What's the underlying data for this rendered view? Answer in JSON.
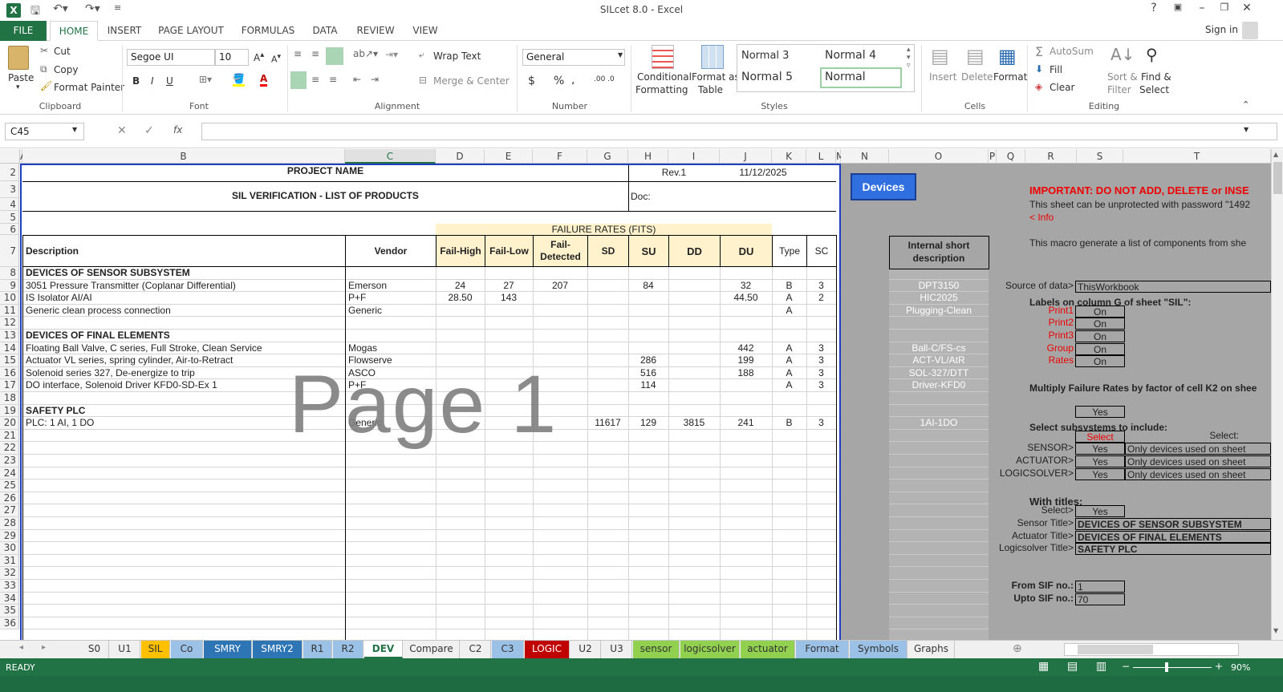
{
  "window": {
    "title": "SILcet 8.0 - Excel",
    "help": "?",
    "signin": "Sign in"
  },
  "menu": {
    "file": "FILE",
    "tabs": [
      "HOME",
      "INSERT",
      "PAGE LAYOUT",
      "FORMULAS",
      "DATA",
      "REVIEW",
      "VIEW"
    ]
  },
  "ribbon": {
    "clipboard": {
      "paste": "Paste",
      "cut": "Cut",
      "copy": "Copy",
      "format_painter": "Format Painter",
      "label": "Clipboard"
    },
    "font": {
      "name": "Segoe UI",
      "size": "10",
      "label": "Font",
      "bold": "B",
      "italic": "I",
      "underline": "U"
    },
    "alignment": {
      "wrap": "Wrap Text",
      "merge": "Merge & Center",
      "label": "Alignment"
    },
    "number": {
      "format": "General",
      "currency": "$",
      "percent": "%",
      "comma": ",",
      "inc": ".00 .0",
      "dec": ".00 .0",
      "label": "Number"
    },
    "styles": {
      "conditional": "Conditional",
      "conditional2": "Formatting",
      "format_as": "Format as",
      "format_as2": "Table",
      "normal3": "Normal 3",
      "normal4": "Normal 4",
      "normal5": "Normal 5",
      "normal": "Normal",
      "label": "Styles"
    },
    "cells": {
      "insert": "Insert",
      "delete": "Delete",
      "format": "Format",
      "label": "Cells"
    },
    "editing": {
      "autosum": "AutoSum",
      "fill": "Fill",
      "clear": "Clear",
      "sort": "Sort &",
      "sort2": "Filter",
      "find": "Find &",
      "find2": "Select",
      "label": "Editing"
    }
  },
  "formula_bar": {
    "namebox": "C45",
    "fx": "fx",
    "value": ""
  },
  "columns": [
    "A",
    "B",
    "C",
    "D",
    "E",
    "F",
    "G",
    "H",
    "I",
    "J",
    "K",
    "L",
    "M",
    "N",
    "O",
    "P",
    "Q",
    "R",
    "S",
    "T"
  ],
  "rows": [
    "2",
    "3",
    "4",
    "5",
    "6",
    "7",
    "8",
    "9",
    "10",
    "11",
    "12",
    "13",
    "14",
    "15",
    "16",
    "17",
    "18",
    "19",
    "20",
    "21",
    "22",
    "23",
    "24",
    "25",
    "26",
    "27",
    "28",
    "29",
    "30",
    "31",
    "32",
    "33",
    "34",
    "35",
    "36"
  ],
  "sheet": {
    "project_name": "PROJECT NAME",
    "rev": "Rev.1",
    "date": "11/12/2025",
    "title": "SIL VERIFICATION - LIST OF PRODUCTS",
    "doc": "Doc:",
    "failure_rates": "FAILURE RATES (FITS)",
    "headers": [
      "Description",
      "Vendor",
      "Fail-High",
      "Fail-Low",
      "Fail-Detected",
      "SD",
      "SU",
      "DD",
      "DU",
      "Type",
      "SC"
    ],
    "watermark": "Page 1",
    "rows": [
      {
        "desc": "DEVICES OF SENSOR SUBSYSTEM",
        "bold": true
      },
      {
        "desc": "3051 Pressure Transmitter (Coplanar Differential)",
        "vendor": "Emerson",
        "fh": "24",
        "fl": "27",
        "fd": "207",
        "sd": "",
        "su": "84",
        "dd": "",
        "du": "32",
        "type": "B",
        "sc": "3",
        "short": "DPT3150"
      },
      {
        "desc": "IS Isolator AI/AI",
        "vendor": "P+F",
        "fh": "28.50",
        "fl": "143",
        "fd": "",
        "sd": "",
        "su": "",
        "dd": "",
        "du": "44.50",
        "type": "A",
        "sc": "2",
        "short": "HIC2025"
      },
      {
        "desc": "Generic clean process connection",
        "vendor": "Generic",
        "fh": "",
        "fl": "",
        "fd": "",
        "sd": "",
        "su": "",
        "dd": "",
        "du": "",
        "type": "A",
        "sc": "",
        "short": "Plugging-Clean"
      },
      {
        "desc": ""
      },
      {
        "desc": "DEVICES OF FINAL ELEMENTS",
        "bold": true
      },
      {
        "desc": "Floating Ball Valve, C series, Full Stroke, Clean Service",
        "vendor": "Mogas",
        "fh": "",
        "fl": "",
        "fd": "",
        "sd": "",
        "su": "",
        "dd": "",
        "du": "442",
        "type": "A",
        "sc": "3",
        "short": "Ball-C/FS-cs"
      },
      {
        "desc": "Actuator VL series, spring cylinder, Air-to-Retract",
        "vendor": "Flowserve",
        "fh": "",
        "fl": "",
        "fd": "",
        "sd": "",
        "su": "286",
        "dd": "",
        "du": "199",
        "type": "A",
        "sc": "3",
        "short": "ACT-VL/AtR"
      },
      {
        "desc": "Solenoid series 327, De-energize to trip",
        "vendor": "ASCO",
        "fh": "",
        "fl": "",
        "fd": "",
        "sd": "",
        "su": "516",
        "dd": "",
        "du": "188",
        "type": "A",
        "sc": "3",
        "short": "SOL-327/DTT"
      },
      {
        "desc": "DO interface, Solenoid Driver KFD0-SD-Ex 1",
        "vendor": "P+F",
        "fh": "",
        "fl": "",
        "fd": "",
        "sd": "",
        "su": "114",
        "dd": "",
        "du": "",
        "type": "A",
        "sc": "3",
        "short": "Driver-KFD0"
      },
      {
        "desc": ""
      },
      {
        "desc": "SAFETY PLC",
        "bold": true
      },
      {
        "desc": "PLC: 1 AI, 1 DO",
        "vendor": "Generic",
        "fh": "",
        "fl": "",
        "fd": "",
        "sd": "11617",
        "su": "129",
        "dd": "3815",
        "du": "241",
        "type": "B",
        "sc": "3",
        "short": "1AI-1DO"
      }
    ]
  },
  "panel": {
    "devices_button": "Devices",
    "important": "IMPORTANT: DO NOT ADD, DELETE or INSE",
    "unprotect": "This sheet can be unprotected with password \"1492",
    "info": "< Info",
    "macro": "This macro generate a list of components from she",
    "internal_short": "Internal short",
    "internal_short2": "description",
    "source_label": "Source of data>",
    "source_value": "ThisWorkbook",
    "labels_title": "Labels on column G of sheet \"SIL\":",
    "labels": [
      {
        "name": "Print1",
        "val": "On"
      },
      {
        "name": "Print2",
        "val": "On"
      },
      {
        "name": "Print3",
        "val": "On"
      },
      {
        "name": "Group",
        "val": "On"
      },
      {
        "name": "Rates",
        "val": "On"
      }
    ],
    "multiply": "Multiply Failure Rates by factor of cell K2 on shee",
    "multiply_val": "Yes",
    "select_title": "Select subsystems to include:",
    "select_hdr": "Select",
    "select_hdr2": "Select:",
    "subsystems": [
      {
        "name": "SENSOR>",
        "val": "Yes",
        "opt": "Only devices used on sheet"
      },
      {
        "name": "ACTUATOR>",
        "val": "Yes",
        "opt": "Only devices used on sheet"
      },
      {
        "name": "LOGICSOLVER>",
        "val": "Yes",
        "opt": "Only devices used on sheet"
      }
    ],
    "with_titles": "With titles:",
    "titles_select_label": "Select>",
    "titles_select_val": "Yes",
    "titles": [
      {
        "name": "Sensor Title>",
        "val": "DEVICES OF SENSOR SUBSYSTEM"
      },
      {
        "name": "Actuator Title>",
        "val": "DEVICES OF FINAL ELEMENTS"
      },
      {
        "name": "Logicsolver Title>",
        "val": "SAFETY PLC"
      }
    ],
    "from_label": "From SIF no.:",
    "from_val": "1",
    "upto_label": "Upto SIF no.:",
    "upto_val": "70"
  },
  "sheet_tabs": [
    {
      "name": "S0",
      "color": ""
    },
    {
      "name": "U1",
      "color": ""
    },
    {
      "name": "SIL",
      "color": "#ffc000"
    },
    {
      "name": "Co",
      "color": "#9bc2e6"
    },
    {
      "name": "SMRY",
      "color": "#2e75b6"
    },
    {
      "name": "SMRY2",
      "color": "#2e75b6"
    },
    {
      "name": "R1",
      "color": "#9bc2e6"
    },
    {
      "name": "R2",
      "color": "#9bc2e6"
    },
    {
      "name": "DEV",
      "color": "active"
    },
    {
      "name": "Compare",
      "color": ""
    },
    {
      "name": "C2",
      "color": ""
    },
    {
      "name": "C3",
      "color": "#9bc2e6"
    },
    {
      "name": "LOGIC",
      "color": "#c00000"
    },
    {
      "name": "U2",
      "color": ""
    },
    {
      "name": "U3",
      "color": ""
    },
    {
      "name": "sensor",
      "color": "#92d050"
    },
    {
      "name": "logicsolver",
      "color": "#92d050"
    },
    {
      "name": "actuator",
      "color": "#92d050"
    },
    {
      "name": "Format",
      "color": "#9bc2e6"
    },
    {
      "name": "Symbols",
      "color": "#9bc2e6"
    },
    {
      "name": "Graphs",
      "color": ""
    }
  ],
  "status": {
    "ready": "READY",
    "zoom": "90%"
  }
}
